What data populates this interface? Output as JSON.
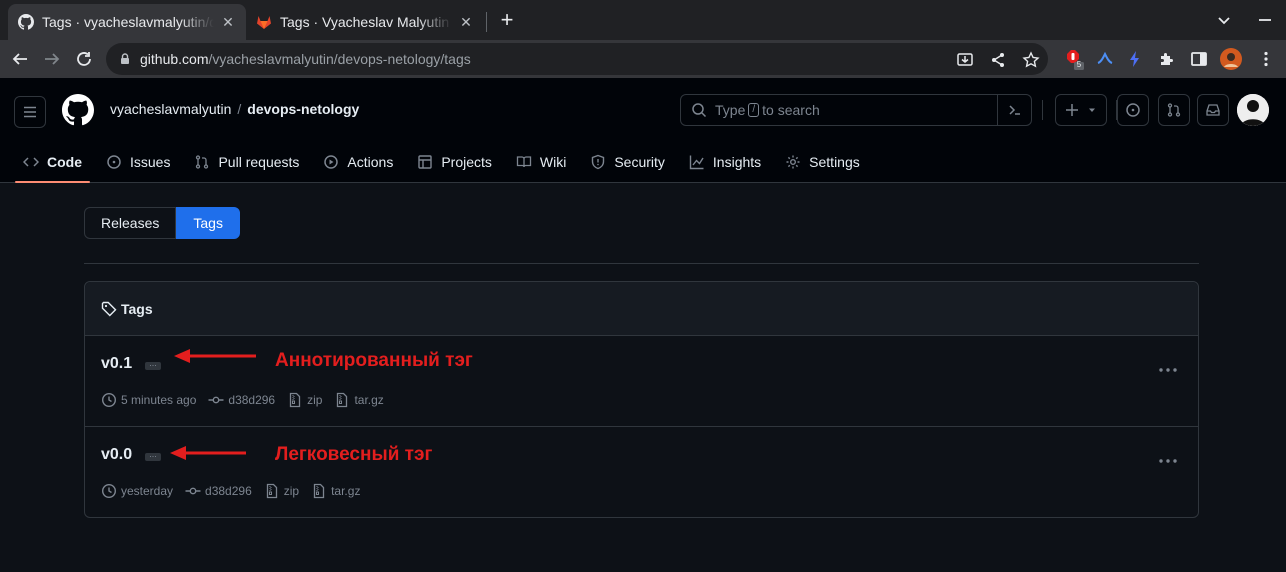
{
  "browser": {
    "tabs": [
      {
        "title": "Tags · vyacheslavmalyutin/devops-netology",
        "active": true
      },
      {
        "title": "Tags · Vyacheslav Malyutin / devops-netology",
        "active": false
      }
    ],
    "url_host": "github.com",
    "url_path": "/vyacheslavmalyutin/devops-netology/tags",
    "extension_badge": "5"
  },
  "header": {
    "owner": "vyacheslavmalyutin",
    "separator": "/",
    "repo": "devops-netology",
    "search_prefix": "Type",
    "search_key": "/",
    "search_suffix": "to search"
  },
  "repo_nav": [
    {
      "label": "Code",
      "icon": "code-icon"
    },
    {
      "label": "Issues",
      "icon": "issue-opened-icon"
    },
    {
      "label": "Pull requests",
      "icon": "git-pull-request-icon"
    },
    {
      "label": "Actions",
      "icon": "play-icon"
    },
    {
      "label": "Projects",
      "icon": "table-icon"
    },
    {
      "label": "Wiki",
      "icon": "book-icon"
    },
    {
      "label": "Security",
      "icon": "shield-icon"
    },
    {
      "label": "Insights",
      "icon": "graph-icon"
    },
    {
      "label": "Settings",
      "icon": "gear-icon"
    }
  ],
  "subnav": {
    "releases": "Releases",
    "tags": "Tags"
  },
  "tags_box": {
    "title": "Tags",
    "items": [
      {
        "name": "v0.1",
        "time": "5 minutes ago",
        "commit": "d38d296",
        "zip": "zip",
        "targz": "tar.gz",
        "annotation": "Аннотированный тэг"
      },
      {
        "name": "v0.0",
        "time": "yesterday",
        "commit": "d38d296",
        "zip": "zip",
        "targz": "tar.gz",
        "annotation": "Легковесный тэг"
      }
    ]
  },
  "colors": {
    "accent": "#1f6feb",
    "annotation": "#e31e1e",
    "nav_underline": "#fd8c73",
    "background": "#0d1117"
  }
}
